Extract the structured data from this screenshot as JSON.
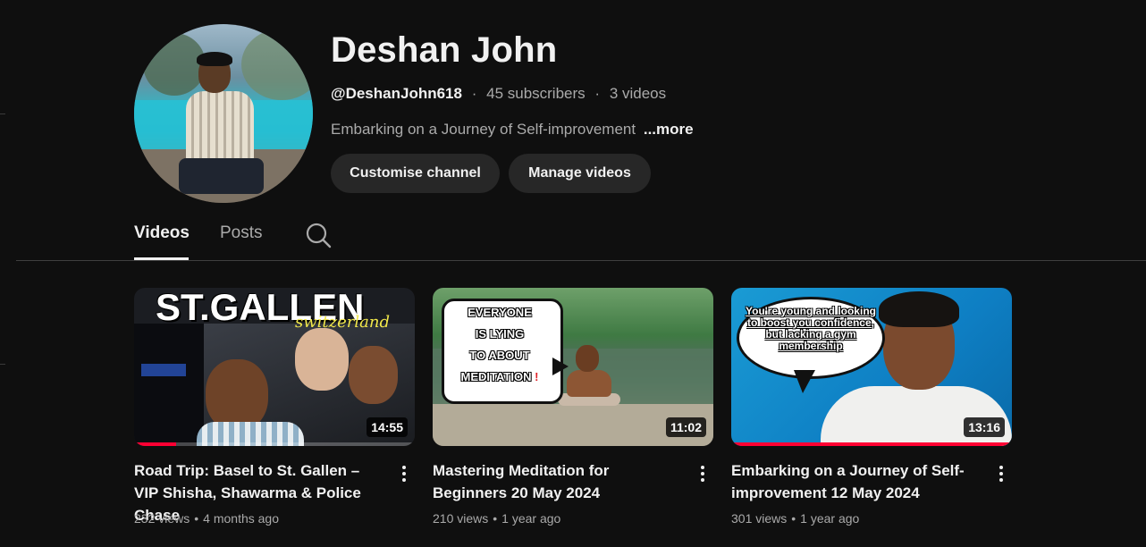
{
  "channel": {
    "name": "Deshan John",
    "handle": "@DeshanJohn618",
    "subscribers": "45 subscribers",
    "videos_count": "3 videos",
    "separator": "·",
    "description": "Embarking on a Journey of Self-improvement",
    "more_label": "...more",
    "avatar_icon": "profile-photo"
  },
  "actions": {
    "customise_label": "Customise channel",
    "manage_label": "Manage videos"
  },
  "tabs": [
    {
      "label": "Videos",
      "active": true
    },
    {
      "label": "Posts",
      "active": false
    }
  ],
  "search_icon": "search-icon",
  "videos": [
    {
      "title": "Road Trip: Basel to St. Gallen – VIP Shisha, Shawarma & Police Chase",
      "views": "232 views",
      "age": "4 months ago",
      "duration": "14:55",
      "watched_fraction": 0.15,
      "thumb_text": "ST.GALLEN",
      "thumb_script": "switzerland"
    },
    {
      "title": "Mastering Meditation for Beginners 20 May 2024",
      "views": "210 views",
      "age": "1 year ago",
      "duration": "11:02",
      "watched_fraction": 0,
      "thumb_lines": [
        "EVERYONE",
        "IS LYING",
        "TO ABOUT",
        "MEDITATION"
      ],
      "thumb_mark": "!"
    },
    {
      "title": "Embarking on a Journey of Self-improvement 12 May 2024",
      "views": "301 views",
      "age": "1 year ago",
      "duration": "13:16",
      "watched_fraction": 1.0,
      "thumb_text": "You're young and looking to boost you confidence, but lacking a gym membership"
    }
  ],
  "colors": {
    "background": "#0f0f0f",
    "text_primary": "#f1f1f1",
    "text_secondary": "#aaaaaa",
    "pill": "#272727",
    "progress": "#ff0033"
  }
}
